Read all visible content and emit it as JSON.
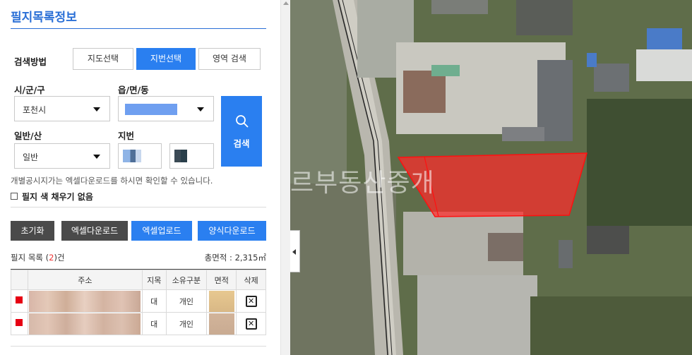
{
  "panel": {
    "title": "필지목록정보",
    "search_method_label": "검색방법",
    "tabs": [
      {
        "label": "지도선택",
        "active": false
      },
      {
        "label": "지번선택",
        "active": true
      },
      {
        "label": "영역 검색",
        "active": false
      }
    ],
    "sido_label": "시/군/구",
    "sido_value": "포천시",
    "eup_label": "읍/면/동",
    "type_label": "일반/산",
    "type_value": "일반",
    "jibun_label": "지번",
    "search_button": "검색",
    "info_text": "개별공시지가는 엑셀다운로드를 하시면 확인할 수 있습니다.",
    "checkbox_label": "필지 색 채우기 없음",
    "buttons": {
      "reset": "초기화",
      "excel_download": "엑셀다운로드",
      "excel_upload": "엑셀업로드",
      "form_download": "양식다운로드"
    },
    "list_label_pre": "필지 목록 (",
    "list_count": "2",
    "list_label_post": ")건",
    "area_total": "총면적 : 2,315㎡",
    "table": {
      "headers": [
        "주소",
        "지목",
        "소유구분",
        "면적",
        "삭제"
      ],
      "rows": [
        {
          "jimok": "대",
          "owner": "개인"
        },
        {
          "jimok": "대",
          "owner": "개인"
        }
      ]
    }
  },
  "map": {
    "watermark": "르부동산중개",
    "highlight_color": "#ff2b2b"
  }
}
